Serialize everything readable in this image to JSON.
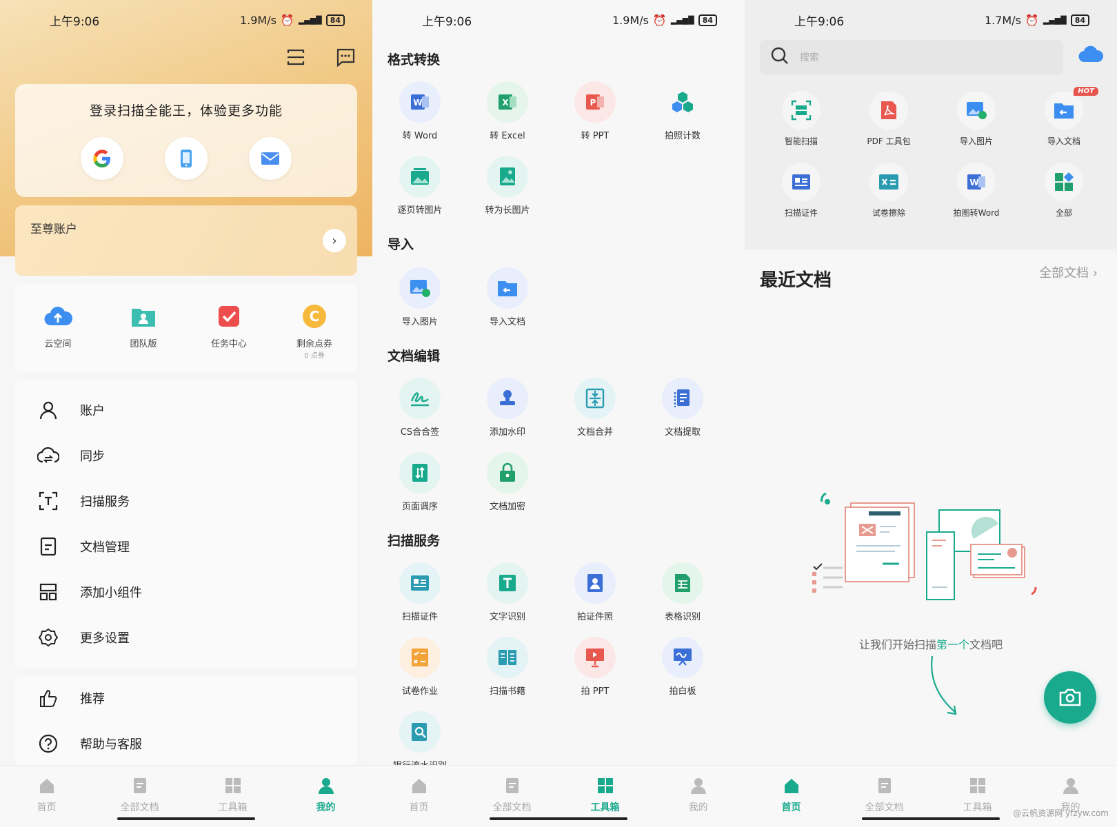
{
  "status": {
    "screen1": {
      "time": "上午9:06",
      "speed": "1.9M/s",
      "battery": "84"
    },
    "screen2": {
      "time": "上午9:06",
      "speed": "1.9M/s",
      "battery": "84"
    },
    "screen3": {
      "time": "上午9:06",
      "speed": "1.7M/s",
      "battery": "84"
    },
    "net": "4G",
    "hd": "HD"
  },
  "me": {
    "login_title": "登录扫描全能王，体验更多功能",
    "premium_label": "至尊账户",
    "quick": [
      {
        "label": "云空间"
      },
      {
        "label": "团队版"
      },
      {
        "label": "任务中心"
      },
      {
        "label": "剩余点券",
        "sub": "0 点券"
      }
    ],
    "menu": [
      "账户",
      "同步",
      "扫描服务",
      "文档管理",
      "添加小组件",
      "更多设置"
    ],
    "menu2": [
      "推荐",
      "帮助与客服"
    ]
  },
  "tools": {
    "sections": [
      "格式转换",
      "导入",
      "文档编辑",
      "扫描服务"
    ],
    "format": [
      "转 Word",
      "转 Excel",
      "转 PPT",
      "拍照计数",
      "逐页转图片",
      "转为长图片"
    ],
    "import": [
      "导入图片",
      "导入文档"
    ],
    "edit": [
      "CS合合签",
      "添加水印",
      "文档合并",
      "文档提取",
      "页面调序",
      "文档加密"
    ],
    "scan": [
      "扫描证件",
      "文字识别",
      "拍证件照",
      "表格识别",
      "试卷作业",
      "扫描书籍",
      "拍 PPT",
      "拍白板",
      "银行流水识别"
    ]
  },
  "home": {
    "search_placeholder": "搜索",
    "grid": [
      "智能扫描",
      "PDF 工具包",
      "导入图片",
      "导入文档",
      "扫描证件",
      "试卷擦除",
      "拍图转Word",
      "全部"
    ],
    "hot_badge": "HOT",
    "recent_title": "最近文档",
    "all_docs": "全部文档",
    "empty_pre": "让我们开始扫描",
    "empty_hl": "第一个",
    "empty_post": "文档吧"
  },
  "nav": [
    "首页",
    "全部文档",
    "工具箱",
    "我的"
  ],
  "watermark": "@云帆资源网 yfzyw.com",
  "colors": {
    "accent": "#19a98d",
    "gold": "#f0c47c",
    "word": "#3c6fd6",
    "excel": "#22a06b",
    "ppt": "#e8584e"
  }
}
